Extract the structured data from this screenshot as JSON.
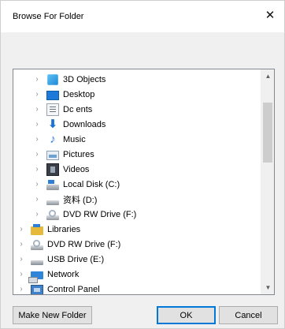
{
  "window": {
    "title": "Browse For Folder",
    "close_glyph": "✕"
  },
  "instruction": "",
  "tree": {
    "items": [
      {
        "label": "3D Objects",
        "icon": "3d-objects-icon",
        "indent": 1
      },
      {
        "label": "Desktop",
        "icon": "desktop-icon",
        "indent": 1
      },
      {
        "label": "Dc       ents",
        "icon": "documents-icon",
        "indent": 1
      },
      {
        "label": "Downloads",
        "icon": "downloads-icon",
        "indent": 1
      },
      {
        "label": "Music",
        "icon": "music-icon",
        "indent": 1
      },
      {
        "label": "Pictures",
        "icon": "pictures-icon",
        "indent": 1
      },
      {
        "label": "Videos",
        "icon": "videos-icon",
        "indent": 1
      },
      {
        "label": "Local Disk (C:)",
        "icon": "local-disk-icon",
        "indent": 1
      },
      {
        "label": "资料 (D:)",
        "icon": "drive-icon",
        "indent": 1
      },
      {
        "label": "DVD RW Drive (F:)",
        "icon": "dvd-drive-icon",
        "indent": 1
      },
      {
        "label": "Libraries",
        "icon": "libraries-icon",
        "indent": 0
      },
      {
        "label": "DVD RW Drive (F:)",
        "icon": "dvd-drive-icon",
        "indent": 0
      },
      {
        "label": "USB Drive (E:)",
        "icon": "usb-drive-icon",
        "indent": 0
      },
      {
        "label": "Network",
        "icon": "network-icon",
        "indent": 0
      },
      {
        "label": "Control Panel",
        "icon": "control-panel-icon",
        "indent": 0
      }
    ],
    "expander_glyph": "›",
    "scroll_up_glyph": "▲",
    "scroll_down_glyph": "▼",
    "scroll_position_fraction": 0.14
  },
  "buttons": {
    "make_new_folder": "Make New Folder",
    "ok": "OK",
    "cancel": "Cancel"
  },
  "colors": {
    "accent": "#0078d7",
    "tree_border": "#828790",
    "dialog_bg": "#f0f0f0"
  }
}
